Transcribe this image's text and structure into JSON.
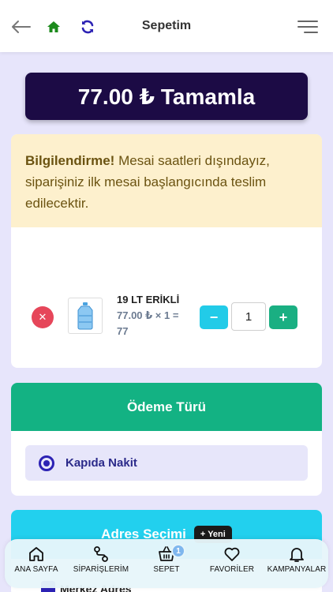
{
  "header": {
    "title": "Sepetim",
    "back_icon": "arrow-left-icon",
    "home_icon": "home-icon",
    "refresh_icon": "refresh-icon",
    "menu_icon": "menu-icon",
    "colors": {
      "home": "#1c8a1c",
      "refresh": "#2c22b4"
    }
  },
  "checkout": {
    "label": "77.00 ₺ Tamamla"
  },
  "info": {
    "bold": "Bilgilendirme!",
    "text": " Mesai saatleri dışındayız, siparişiniz ilk mesai başlangıcında teslim edilecektir."
  },
  "cart": {
    "items": [
      {
        "name": "19 LT ERİKLİ",
        "price_line": "77.00 ₺ × 1 = 77",
        "quantity": "1",
        "minus": "−",
        "plus": "+",
        "remove": "✕",
        "image_icon": "water-bottle-icon"
      }
    ]
  },
  "payment": {
    "title": "Ödeme Türü",
    "options": [
      {
        "label": "Kapıda Nakit",
        "selected": true
      }
    ]
  },
  "address": {
    "title": "Adres Seçimi",
    "new_button": "+ Yeni",
    "items": [
      {
        "label": "Merkez Adres"
      }
    ]
  },
  "bottom_nav": {
    "items": [
      {
        "label": "ANA SAYFA",
        "icon": "home-icon"
      },
      {
        "label": "SİPARİŞLERİM",
        "icon": "route-icon"
      },
      {
        "label": "SEPET",
        "icon": "basket-icon",
        "badge": "1"
      },
      {
        "label": "FAVORİLER",
        "icon": "heart-icon"
      },
      {
        "label": "KAMPANYALAR",
        "icon": "bell-icon"
      }
    ]
  },
  "colors": {
    "background": "#e7e5fb",
    "checkout_bg": "#1c0b45",
    "alert_bg": "#fdf0cd",
    "alert_text": "#6b5311",
    "danger": "#e6465a",
    "qty_minus": "#22cbe8",
    "qty_plus": "#1aaf82",
    "payment_head": "#13b283",
    "address_head": "#22d0ee",
    "radio": "#2c22b4"
  }
}
